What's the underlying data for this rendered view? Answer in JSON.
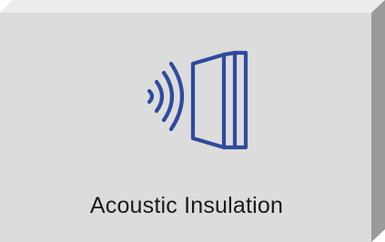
{
  "tile": {
    "label": "Acoustic Insulation",
    "icon": "sound-through-wall-icon",
    "colors": {
      "face": "#dcdcdc",
      "top_edge": "#ececec",
      "side_edge": "#9a9a9a",
      "bottom_edge": "#8a8a8a",
      "icon_stroke": "#2f4a9e",
      "text": "#1a1a1a"
    }
  }
}
